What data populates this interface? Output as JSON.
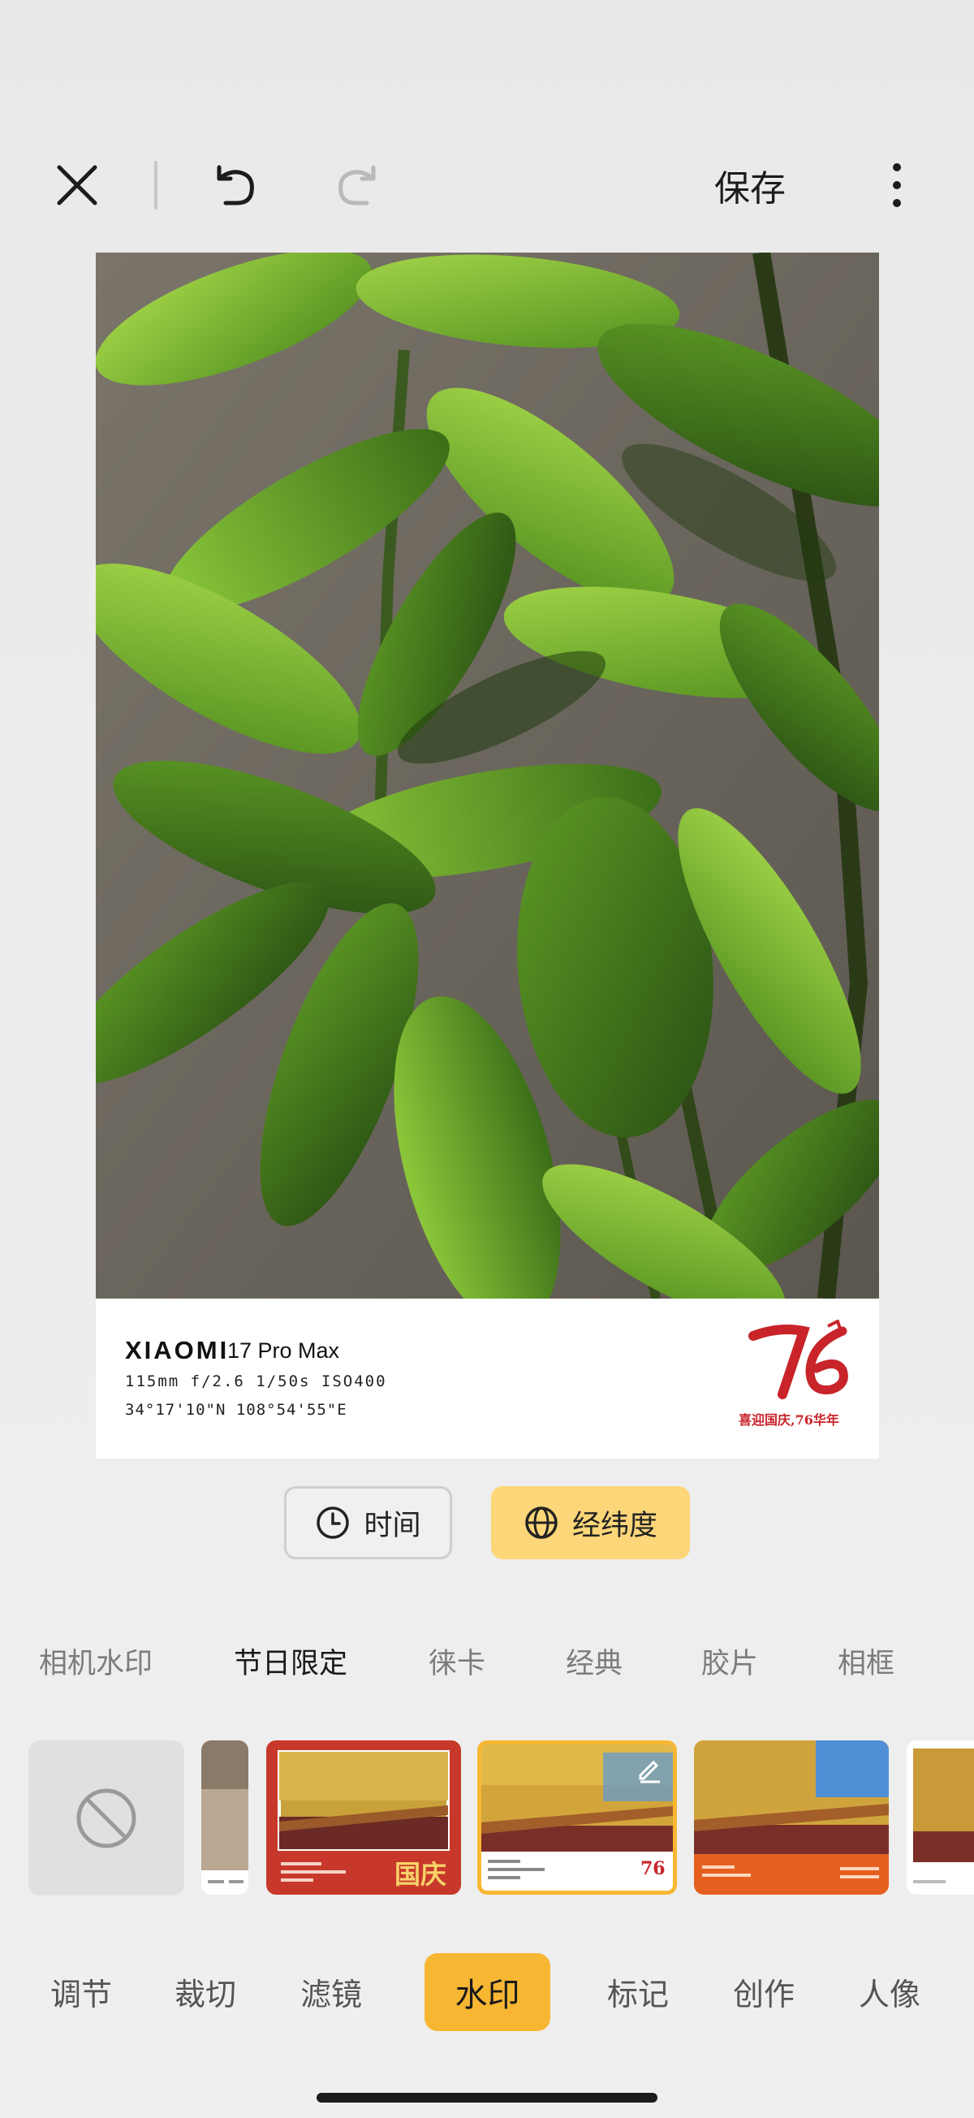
{
  "toolbar": {
    "close_icon": "close-icon",
    "undo_icon": "undo-icon",
    "redo_icon": "redo-icon",
    "save_label": "保存",
    "more_icon": "more-vertical-icon"
  },
  "watermark": {
    "brand": "XIAOMI",
    "model": "17 Pro Max",
    "params": "115mm  f/2.6  1/50s  ISO400",
    "coords": "34°17'10\"N  108°54'55\"E",
    "logo_number": "76",
    "logo_caption": "喜迎国庆,76华年"
  },
  "chips": [
    {
      "label": "时间",
      "icon": "clock-icon",
      "selected": false
    },
    {
      "label": "经纬度",
      "icon": "globe-icon",
      "selected": true
    }
  ],
  "categories": [
    "相机水印",
    "节日限定",
    "徕卡",
    "经典",
    "胶片",
    "相框"
  ],
  "active_category": "节日限定",
  "thumbnails": {
    "none_icon": "prohibited-icon",
    "guoqing_label": "国庆",
    "selected_logo": "76",
    "edit_icon": "pencil-icon"
  },
  "tabs": [
    "调节",
    "裁切",
    "滤镜",
    "水印",
    "标记",
    "创作",
    "人像"
  ],
  "active_tab": "水印",
  "colors": {
    "accent": "#f8b733",
    "chip_selected": "#fdd679",
    "festival_red": "#c8242a"
  }
}
